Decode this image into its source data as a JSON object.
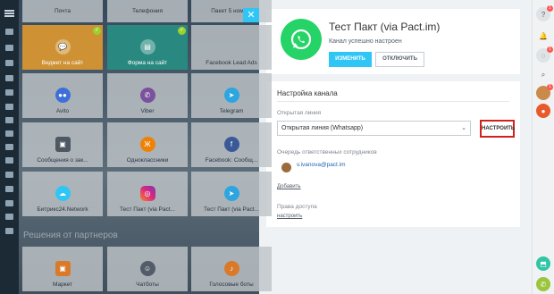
{
  "grid": {
    "top_row": [
      "Почта",
      "Телефония",
      "Пакет 5 номе..."
    ],
    "rows": [
      [
        {
          "label": "Виджет на сайт",
          "icon": "chat-icon",
          "active": "orange"
        },
        {
          "label": "Форма на сайт",
          "icon": "form-icon",
          "active": "teal"
        },
        {
          "label": "Facebook Lead Ads",
          "icon": "",
          "active": ""
        }
      ],
      [
        {
          "label": "Avito",
          "icon": "avito-icon",
          "active": ""
        },
        {
          "label": "Viber",
          "icon": "viber-icon",
          "active": ""
        },
        {
          "label": "Telegram",
          "icon": "telegram-icon",
          "active": ""
        }
      ],
      [
        {
          "label": "Сообщения о зак...",
          "icon": "shop-icon",
          "active": ""
        },
        {
          "label": "Одноклассники",
          "icon": "ok-icon",
          "active": ""
        },
        {
          "label": "Facebook: Сообщ...",
          "icon": "facebook-icon",
          "active": ""
        }
      ],
      [
        {
          "label": "Битрикс24.Network",
          "icon": "cloud-icon",
          "active": ""
        },
        {
          "label": "Тест Пакт (via Pact...",
          "icon": "instagram-icon",
          "active": ""
        },
        {
          "label": "Тест Пакт (via Pact...",
          "icon": "telegram-icon",
          "active": ""
        }
      ]
    ],
    "partners_label": "Решения от партнеров",
    "partner_row": [
      "Маркет",
      "Чатботы",
      "Голосовые боты"
    ]
  },
  "channel": {
    "title": "Тест Пакт (via Pact.im)",
    "status": "Канал успешно настроен",
    "change_button": "ИЗМЕНИТЬ",
    "disable_button": "ОТКЛЮЧИТЬ"
  },
  "settings": {
    "title": "Настройка канала",
    "open_line_label": "Открытая линия",
    "open_line_value": "Открытая линия (Whatsapp)",
    "setup_button": "НАСТРОИТЬ",
    "queue_label": "Очередь ответственных сотрудников",
    "queue_user": "v.ivanova@pact.im",
    "add_link": "Добавить",
    "access_label": "Права доступа",
    "access_link": "настроить"
  },
  "rightbar": {
    "help_badge": "1",
    "chat_badge": "1",
    "user_badge": "1"
  },
  "colors": {
    "accent": "#2fc6f6",
    "whatsapp": "#25d366",
    "highlight": "#d0211c"
  }
}
